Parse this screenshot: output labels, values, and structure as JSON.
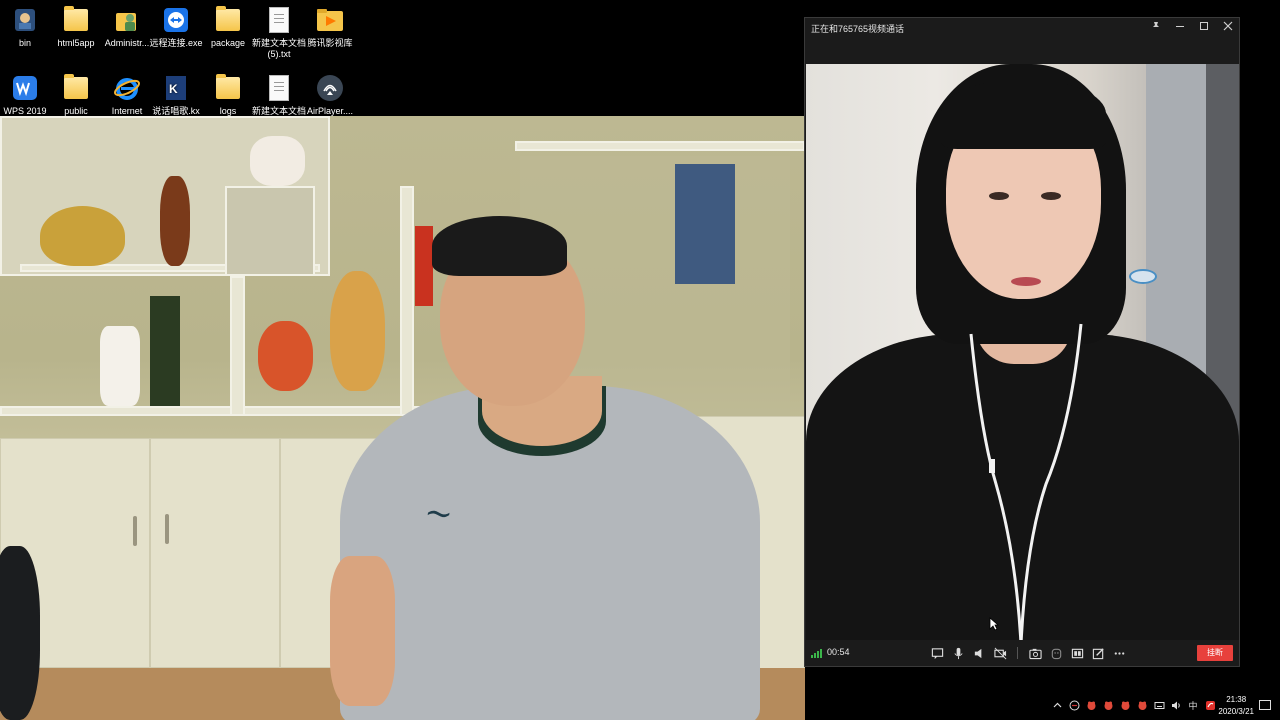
{
  "desktop": {
    "icons": [
      {
        "label": "bin",
        "icon": "bin-app-icon"
      },
      {
        "label": "html5app",
        "icon": "folder-icon"
      },
      {
        "label": "Administr...",
        "icon": "user-folder-icon"
      },
      {
        "label": "远程连接.exe",
        "icon": "teamviewer-icon"
      },
      {
        "label": "package",
        "icon": "folder-icon"
      },
      {
        "label": "新建文本文档 (5).txt",
        "icon": "text-file-icon"
      },
      {
        "label": "腾讯影视库",
        "icon": "video-folder-icon"
      },
      {
        "label": "WPS 2019",
        "icon": "wps-icon"
      },
      {
        "label": "public",
        "icon": "folder-icon"
      },
      {
        "label": "Internet",
        "icon": "ie-icon"
      },
      {
        "label": "说话唱歌.kx",
        "icon": "kx-file-icon"
      },
      {
        "label": "logs",
        "icon": "folder-icon"
      },
      {
        "label": "新建文本文档",
        "icon": "text-file-icon"
      },
      {
        "label": "AirPlayer....",
        "icon": "airplayer-icon"
      }
    ]
  },
  "call_window": {
    "title": "正在和765765视频通话",
    "controls": [
      "pin-icon",
      "minimize-icon",
      "maximize-icon",
      "close-icon"
    ],
    "timer": "00:54",
    "tools": [
      "chat-icon",
      "microphone-icon",
      "speaker-icon",
      "camera-off-icon",
      "screenshot-icon",
      "beauty-icon",
      "layout-icon",
      "edit-icon",
      "more-icon"
    ],
    "hangup_label": "挂断",
    "hangup_color": "#e8413c"
  },
  "taskbar": {
    "time": "21:38",
    "date": "2020/3/21",
    "ime": "中",
    "tray": [
      "chevron-up-icon",
      "network-icon",
      "app-tray-icon",
      "app-tray-icon",
      "app-tray-icon",
      "app-tray-icon",
      "keyboard-icon",
      "volume-icon",
      "ime-icon",
      "antivirus-icon"
    ]
  }
}
